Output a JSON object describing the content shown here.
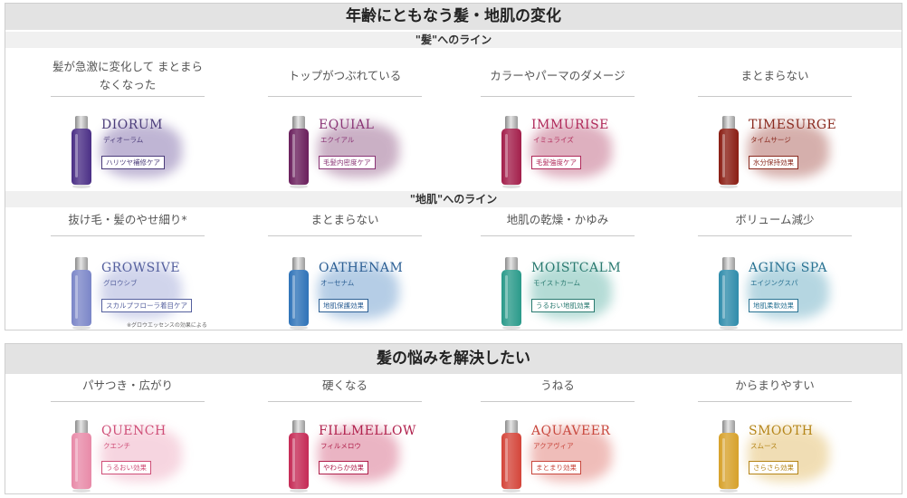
{
  "top_panel": {
    "title": "年齢にともなう髪・地肌の変化",
    "hair_line": {
      "heading": "\"髪\"へのライン",
      "products": [
        {
          "concern": "髪が急激に変化して まとまらなくなった",
          "name": "DIORUM",
          "kana": "ディオーラム",
          "badge": "ハリツヤ補修ケア",
          "color": "#4b2f86",
          "text_color": "#4b3c7a"
        },
        {
          "concern": "トップがつぶれている",
          "name": "EQUIAL",
          "kana": "エクイアル",
          "badge": "毛髪内密度ケア",
          "color": "#6a1f5c",
          "text_color": "#8a3576"
        },
        {
          "concern": "カラーやパーマのダメージ",
          "name": "IMMURISE",
          "kana": "イミュライズ",
          "badge": "毛髪強度ケア",
          "color": "#a31f4b",
          "text_color": "#b02a5a"
        },
        {
          "concern": "まとまらない",
          "name": "TIMESURGE",
          "kana": "タイムサージ",
          "badge": "水分保持効果",
          "color": "#8a1d13",
          "text_color": "#8a2a1f"
        }
      ]
    },
    "scalp_line": {
      "heading": "\"地肌\"へのライン",
      "products": [
        {
          "concern": "抜け毛・髪のやせ細り*",
          "name": "GROWSIVE",
          "kana": "グロウシブ",
          "badge": "スカルプフローラ着目ケア",
          "color": "#7b86c8",
          "text_color": "#55609e"
        },
        {
          "concern": "まとまらない",
          "name": "OATHENAM",
          "kana": "オーセナム",
          "badge": "地肌保護効果",
          "color": "#2f73b8",
          "text_color": "#2c5f94"
        },
        {
          "concern": "地肌の乾燥・かゆみ",
          "name": "MOISTCALM",
          "kana": "モイストカーム",
          "badge": "うるおい地肌効果",
          "color": "#2a9a8a",
          "text_color": "#2a7a70"
        },
        {
          "concern": "ボリューム減少",
          "name": "AGING SPA",
          "kana": "エイジングスパ",
          "badge": "地肌柔軟効果",
          "color": "#2f8cab",
          "text_color": "#2a7393"
        }
      ],
      "footnote": "※グロウエッセンスの効果による"
    }
  },
  "bottom_panel": {
    "title": "髪の悩みを解決したい",
    "products": [
      {
        "concern": "パサつき・広がり",
        "name": "QUENCH",
        "kana": "クエンチ",
        "badge": "うるおい効果",
        "color": "#e88aa8",
        "text_color": "#cf4f78"
      },
      {
        "concern": "硬くなる",
        "name": "FILLMELLOW",
        "kana": "フィルメロウ",
        "badge": "やわらか効果",
        "color": "#c52a55",
        "text_color": "#b0204c"
      },
      {
        "concern": "うねる",
        "name": "AQUAVEER",
        "kana": "アクアヴィア",
        "badge": "まとまり効果",
        "color": "#d4453a",
        "text_color": "#c8473d"
      },
      {
        "concern": "からまりやすい",
        "name": "SMOOTH",
        "kana": "スムース",
        "badge": "さらさら効果",
        "color": "#d7a12a",
        "text_color": "#b58518"
      }
    ]
  }
}
